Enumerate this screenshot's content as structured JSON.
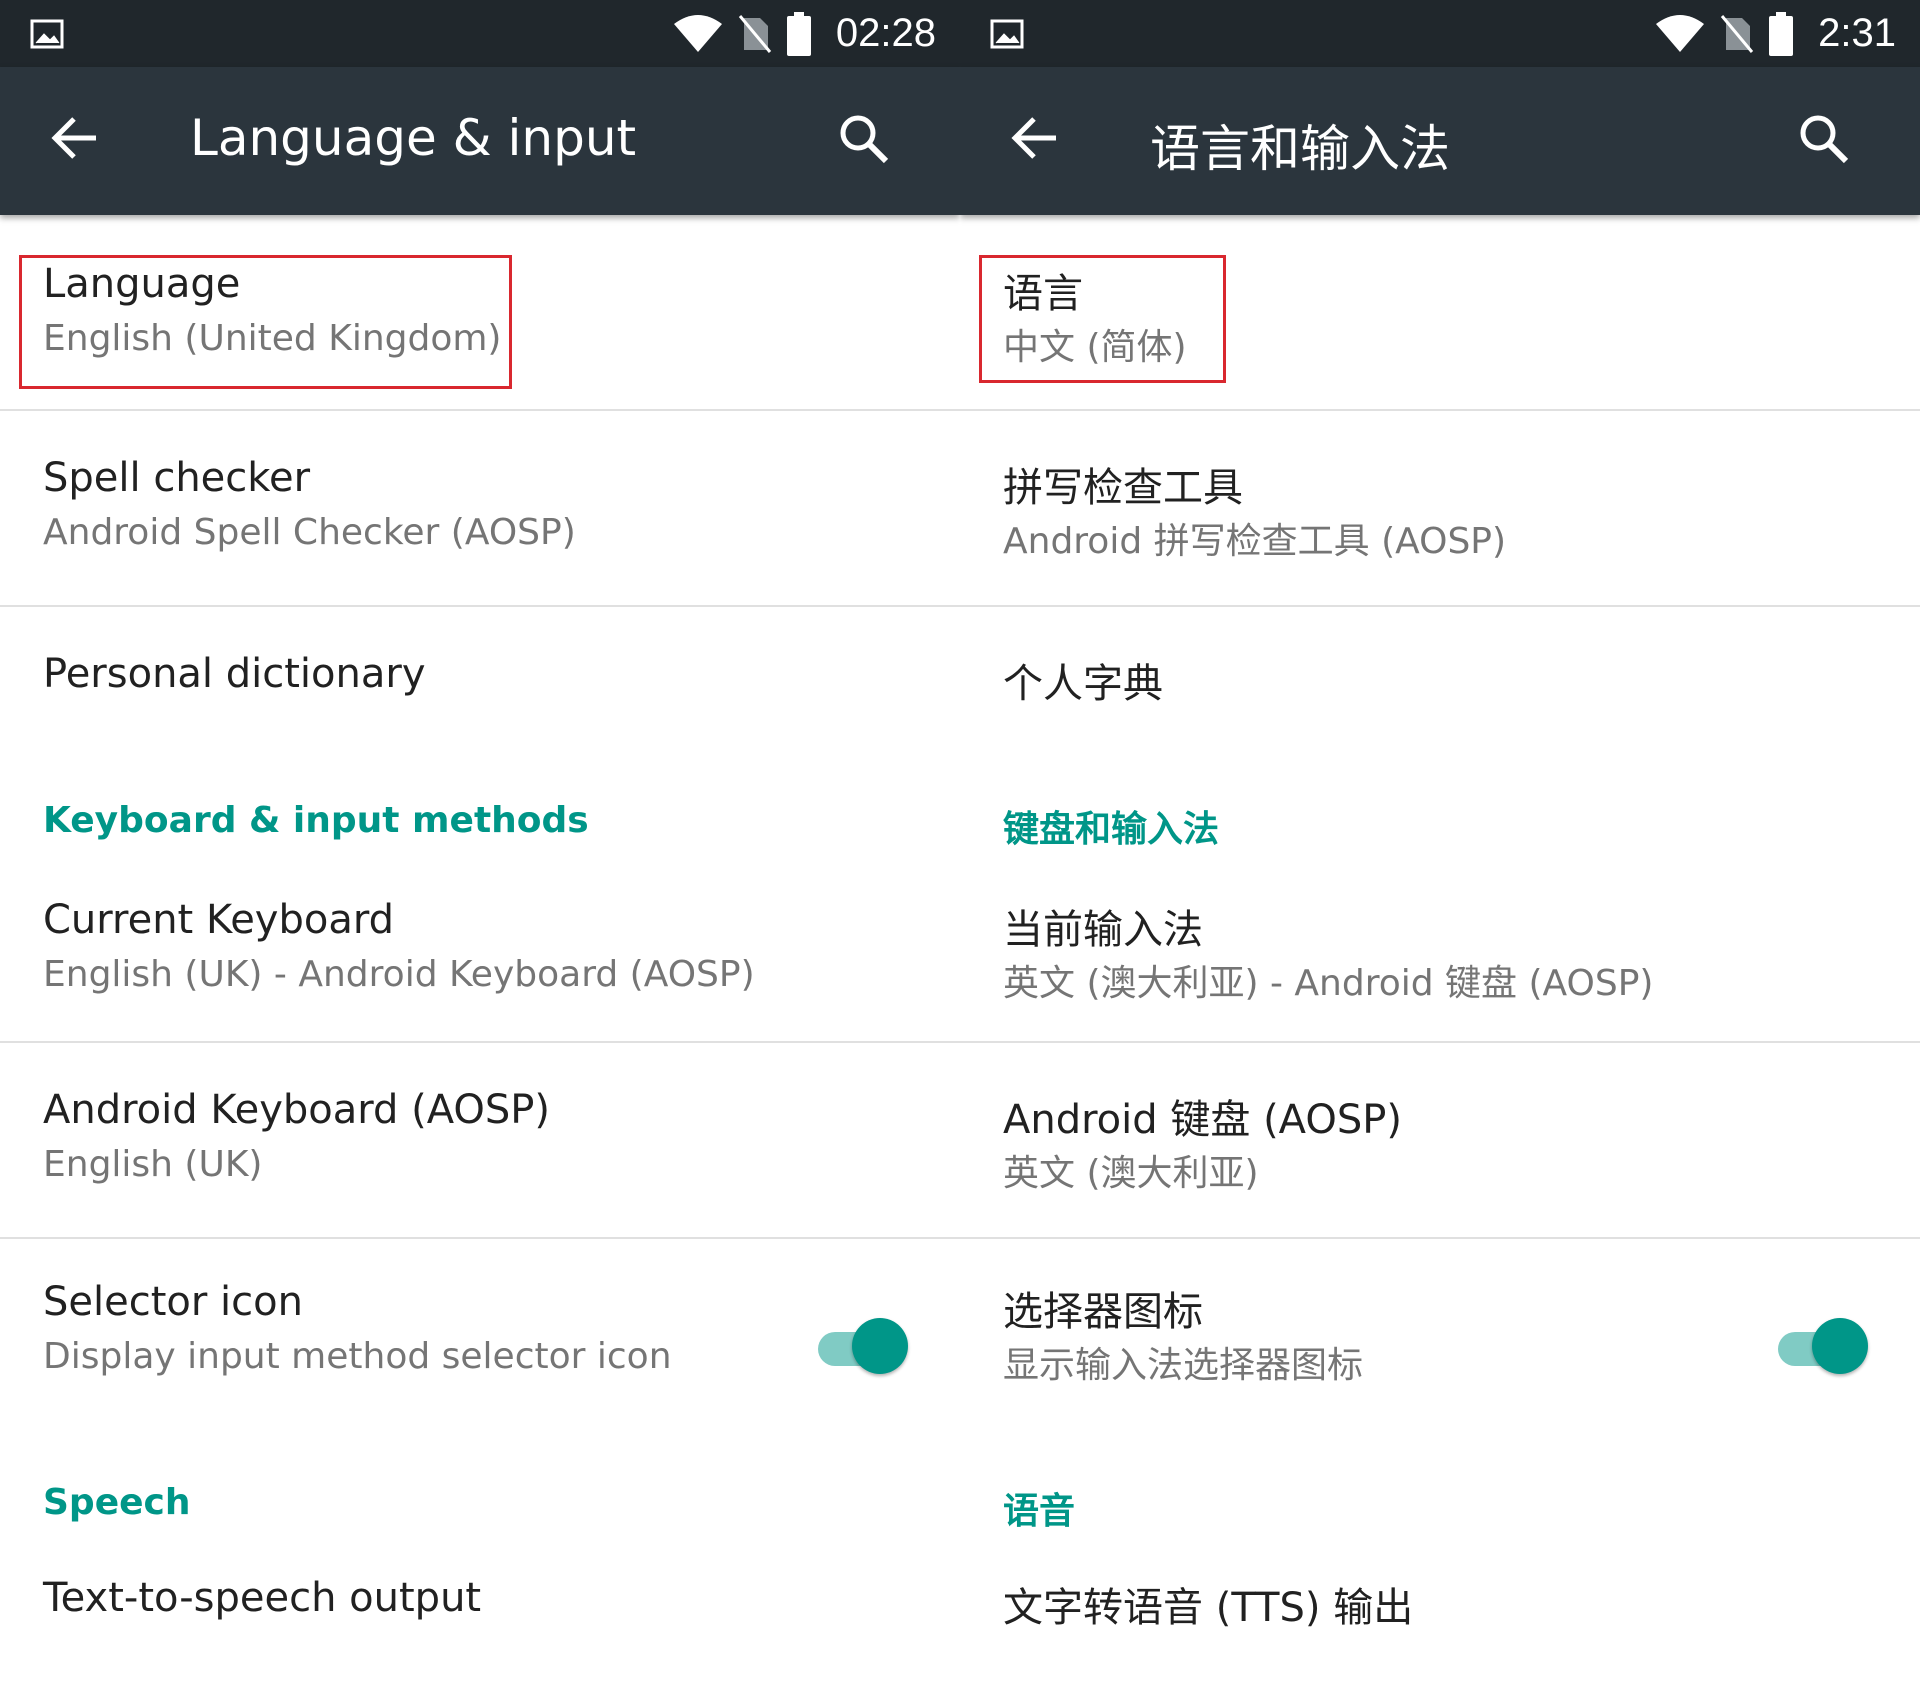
{
  "screens": [
    {
      "status_bar": {
        "time": "02:28"
      },
      "app_bar": {
        "title": "Language & input",
        "icons": [
          "back-arrow-icon",
          "search-icon"
        ]
      },
      "items": {
        "language": {
          "title": "Language",
          "subtitle": "English (United Kingdom)"
        },
        "spell_checker": {
          "title": "Spell checker",
          "subtitle": "Android Spell Checker (AOSP)"
        },
        "personal_dictionary": {
          "title": "Personal dictionary"
        },
        "keyboard_section": "Keyboard & input methods",
        "current_keyboard": {
          "title": "Current Keyboard",
          "subtitle": "English (UK) - Android Keyboard (AOSP)"
        },
        "android_keyboard": {
          "title": "Android Keyboard (AOSP)",
          "subtitle": "English (UK)"
        },
        "selector_icon": {
          "title": "Selector icon",
          "subtitle": "Display input method selector icon",
          "toggle_on": true
        },
        "speech_section": "Speech",
        "tts_output": {
          "title": "Text-to-speech output"
        }
      }
    },
    {
      "status_bar": {
        "time": "2:31"
      },
      "app_bar": {
        "title": "语言和输入法",
        "icons": [
          "back-arrow-icon",
          "search-icon"
        ]
      },
      "items": {
        "language": {
          "title": "语言",
          "subtitle": "中文 (简体)"
        },
        "spell_checker": {
          "title": "拼写检查工具",
          "subtitle": "Android 拼写检查工具 (AOSP)"
        },
        "personal_dictionary": {
          "title": "个人字典"
        },
        "keyboard_section": "键盘和输入法",
        "current_keyboard": {
          "title": "当前输入法",
          "subtitle": "英文 (澳大利亚) - Android 键盘 (AOSP)"
        },
        "android_keyboard": {
          "title": "Android 键盘 (AOSP)",
          "subtitle": "英文 (澳大利亚)"
        },
        "selector_icon": {
          "title": "选择器图标",
          "subtitle": "显示输入法选择器图标",
          "toggle_on": true
        },
        "speech_section": "语音",
        "tts_output": {
          "title": "文字转语音 (TTS) 输出"
        }
      }
    }
  ],
  "colors": {
    "status_bar": "#20272c",
    "app_bar": "#2b353d",
    "accent": "#009688",
    "toggle_track": "#80cbc4",
    "highlight_box": "#d9282f",
    "primary_text": "#212121",
    "secondary_text": "#757575"
  }
}
